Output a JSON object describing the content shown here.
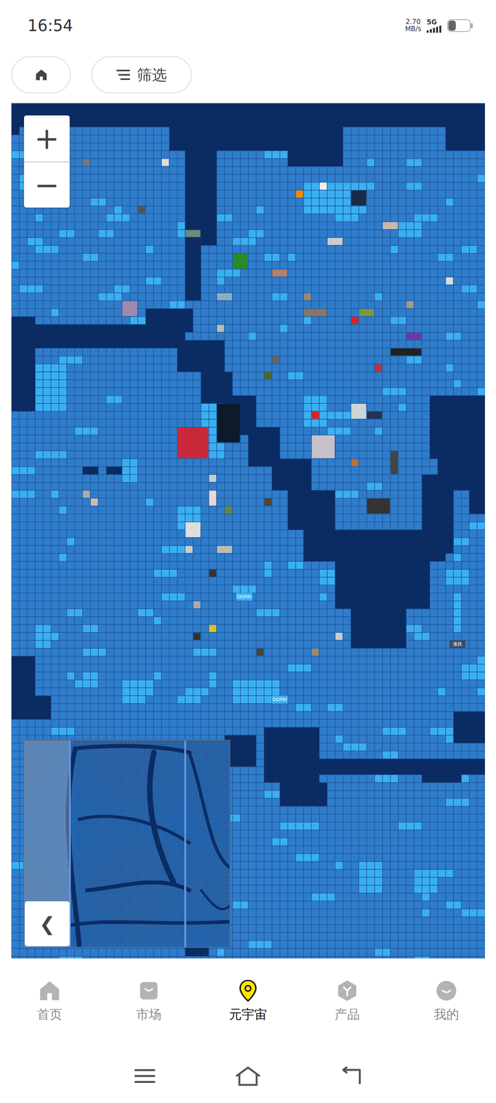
{
  "status_bar": {
    "time": "16:54",
    "speed": "2.70",
    "speed_unit": "MB/s",
    "network": "5G",
    "battery_level": 0.35
  },
  "toolbar": {
    "filter": "筛选"
  },
  "zoom": {
    "in": "+",
    "out": "−"
  },
  "map": {
    "labels": [
      {
        "text": "DOPAI"
      },
      {
        "text": "DOPAI"
      },
      {
        "text": "涨跌"
      }
    ]
  },
  "minimap": {
    "collapse": "❮"
  },
  "bottom_nav": [
    {
      "label": "首页",
      "selected": false
    },
    {
      "label": "市场",
      "selected": false
    },
    {
      "label": "元宇宙",
      "selected": true
    },
    {
      "label": "产品",
      "selected": false
    },
    {
      "label": "我的",
      "selected": false
    }
  ]
}
